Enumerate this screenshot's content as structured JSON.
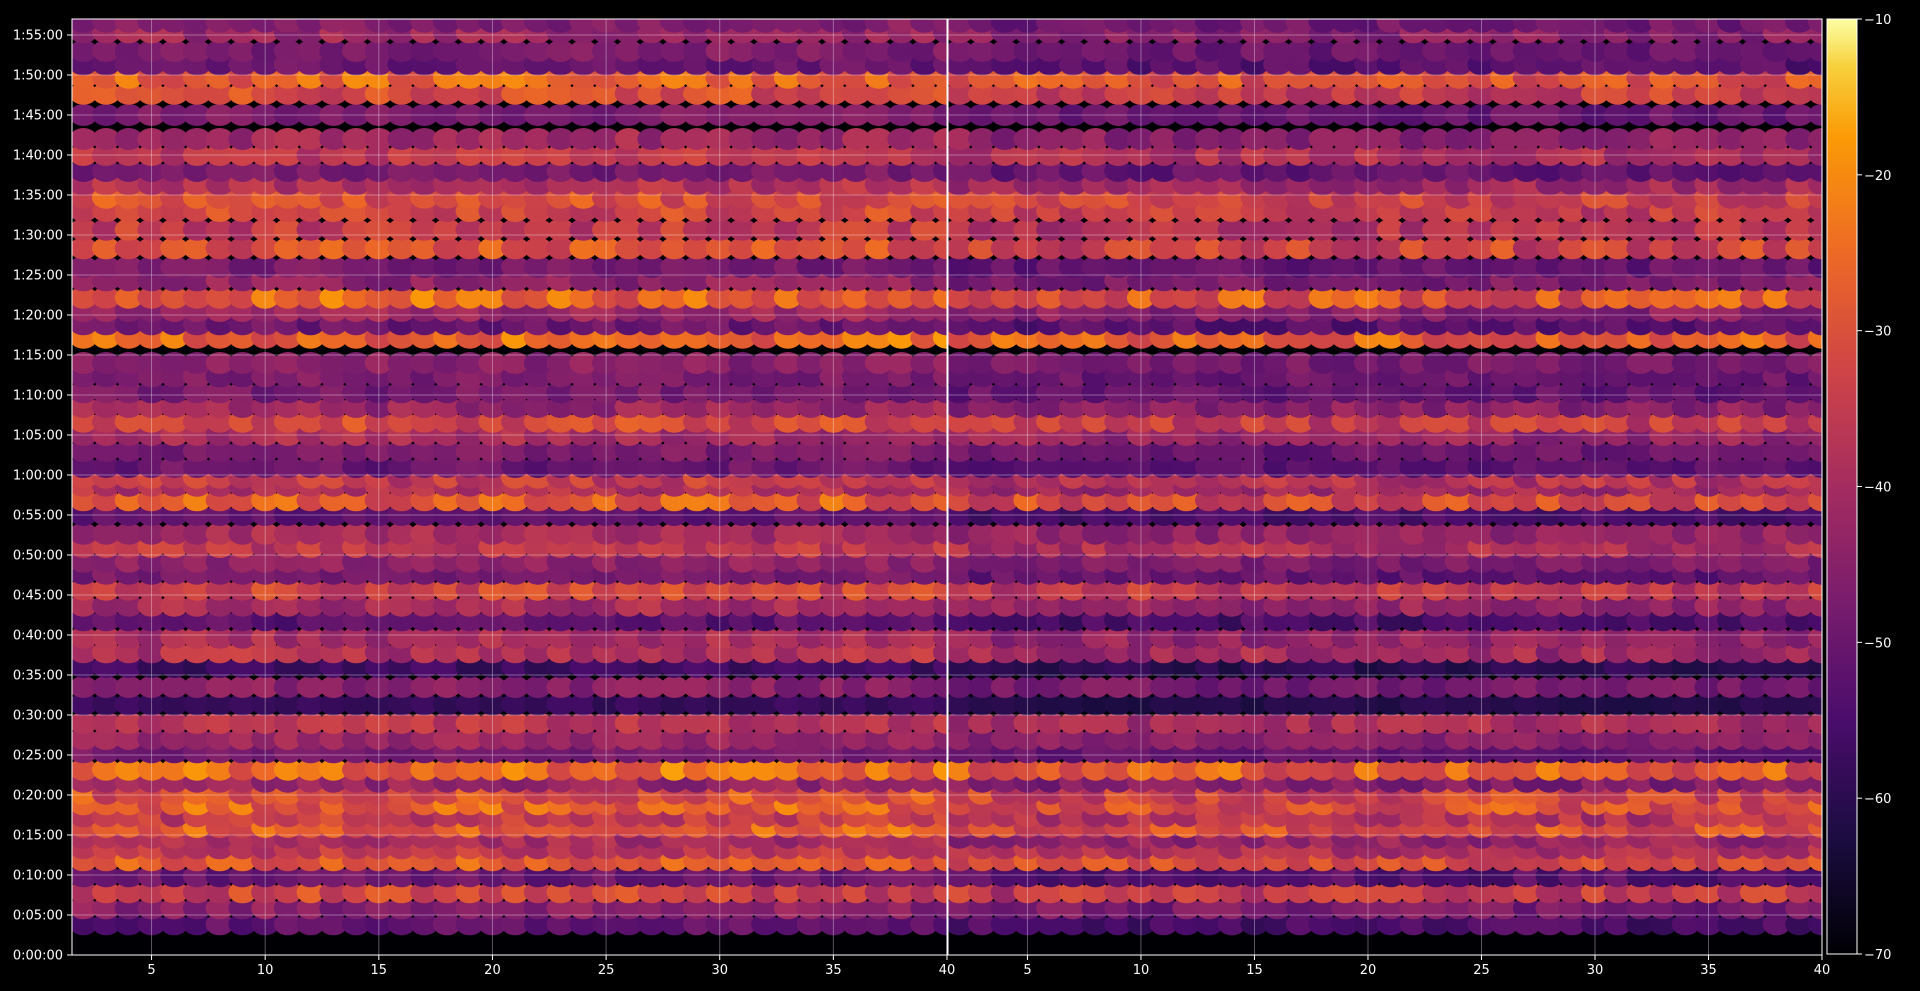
{
  "chart_data": {
    "type": "heatmap",
    "title": "",
    "panels": [
      {
        "name": "",
        "x_ticks": [
          "5",
          "10",
          "15",
          "20",
          "25",
          "30",
          "35",
          "40"
        ],
        "x_tick_values": [
          5,
          10,
          15,
          20,
          25,
          30,
          35,
          40
        ],
        "xlim": [
          1.5,
          40
        ]
      },
      {
        "name": "",
        "x_ticks": [
          "5",
          "10",
          "15",
          "20",
          "25",
          "30",
          "35",
          "40"
        ],
        "x_tick_values": [
          5,
          10,
          15,
          20,
          25,
          30,
          35,
          40
        ],
        "xlim": [
          1.5,
          40
        ]
      }
    ],
    "y_ticks": [
      "0:00:00",
      "0:05:00",
      "0:10:00",
      "0:15:00",
      "0:20:00",
      "0:25:00",
      "0:30:00",
      "0:35:00",
      "0:40:00",
      "0:45:00",
      "0:50:00",
      "0:55:00",
      "1:00:00",
      "1:05:00",
      "1:10:00",
      "1:15:00",
      "1:20:00",
      "1:25:00",
      "1:30:00",
      "1:35:00",
      "1:40:00",
      "1:45:00",
      "1:50:00",
      "1:55:00"
    ],
    "y_tick_seconds": [
      0,
      300,
      600,
      900,
      1200,
      1500,
      1800,
      2100,
      2400,
      2700,
      3000,
      3300,
      3600,
      3900,
      4200,
      4500,
      4800,
      5100,
      5400,
      5700,
      6000,
      6300,
      6600,
      6900
    ],
    "ylim_seconds": [
      0,
      7020
    ],
    "colorbar": {
      "colormap": "inferno",
      "range": [
        -70,
        -10
      ],
      "ticks": [
        "−10",
        "−20",
        "−30",
        "−40",
        "−50",
        "−60",
        "−70"
      ],
      "tick_values": [
        -10,
        -20,
        -30,
        -40,
        -50,
        -60,
        -70
      ]
    },
    "grid": true,
    "x_bins": 39,
    "row_seconds": [
      230,
      350,
      470,
      590,
      710,
      800,
      880,
      960,
      1040,
      1130,
      1210,
      1300,
      1390,
      1520,
      1620,
      1740,
      1880,
      2010,
      2160,
      2270,
      2380,
      2510,
      2620,
      2740,
      2860,
      2950,
      3060,
      3160,
      3300,
      3410,
      3520,
      3580,
      3660,
      3780,
      3900,
      4000,
      4110,
      4220,
      4340,
      4440,
      4630,
      4730,
      4830,
      4930,
      5060,
      5160,
      5300,
      5440,
      5580,
      5680,
      5780,
      5880,
      6000,
      6120,
      6300,
      6460,
      6580,
      6680,
      6780,
      6920,
      7000
    ],
    "row_levels_dB": [
      -52,
      -45,
      -33,
      -50,
      -28,
      -36,
      -40,
      -27,
      -35,
      -27,
      -30,
      -43,
      -25,
      -48,
      -42,
      -37,
      -58,
      -45,
      -57,
      -38,
      -40,
      -52,
      -40,
      -33,
      -48,
      -44,
      -36,
      -40,
      -52,
      -28,
      -38,
      -35,
      -50,
      -47,
      -40,
      -32,
      -42,
      -48,
      -47,
      -45,
      -25,
      -50,
      -42,
      -26,
      -44,
      -48,
      -30,
      -35,
      -32,
      -30,
      -38,
      -48,
      -36,
      -41,
      -47,
      -31,
      -26,
      -50,
      -47,
      -42,
      -46
    ],
    "row_amplitude_dB": [
      4,
      5,
      7,
      4,
      6,
      5,
      5,
      7,
      6,
      8,
      7,
      5,
      8,
      3,
      4,
      5,
      2,
      4,
      3,
      6,
      5,
      4,
      5,
      6,
      4,
      4,
      5,
      5,
      3,
      7,
      5,
      6,
      4,
      4,
      5,
      6,
      5,
      4,
      4,
      4,
      8,
      4,
      5,
      8,
      5,
      4,
      7,
      6,
      6,
      6,
      5,
      4,
      5,
      5,
      4,
      6,
      7,
      4,
      4,
      5,
      4
    ],
    "right_panel_offset_dB": -3
  }
}
